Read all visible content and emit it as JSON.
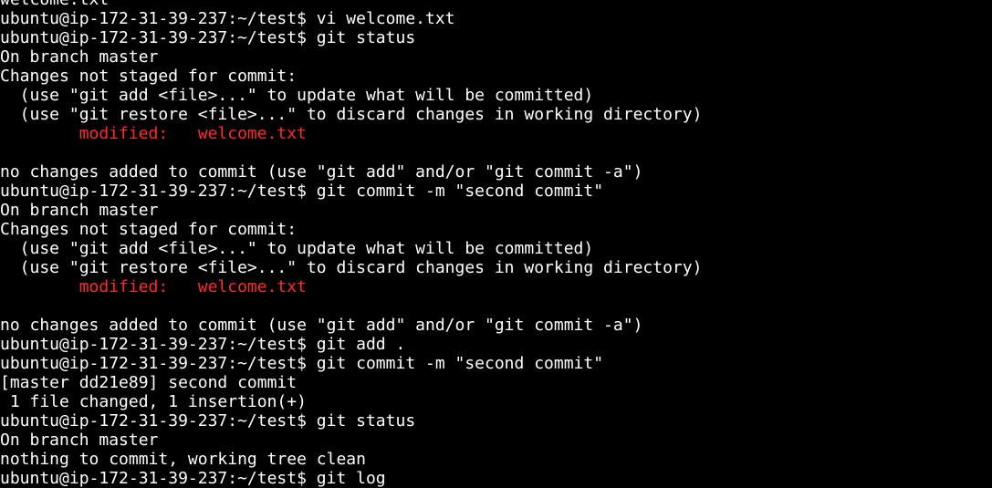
{
  "terminal": {
    "lines": [
      {
        "text": "welcome.txt"
      },
      {
        "text": "ubuntu@ip-172-31-39-237:~/test$ vi welcome.txt"
      },
      {
        "text": "ubuntu@ip-172-31-39-237:~/test$ git status"
      },
      {
        "text": "On branch master"
      },
      {
        "text": "Changes not staged for commit:"
      },
      {
        "text": "  (use \"git add <file>...\" to update what will be committed)"
      },
      {
        "text": "  (use \"git restore <file>...\" to discard changes in working directory)"
      },
      {
        "text": "        modified:   welcome.txt",
        "color": "red"
      },
      {
        "text": ""
      },
      {
        "text": "no changes added to commit (use \"git add\" and/or \"git commit -a\")"
      },
      {
        "text": "ubuntu@ip-172-31-39-237:~/test$ git commit -m \"second commit\""
      },
      {
        "text": "On branch master"
      },
      {
        "text": "Changes not staged for commit:"
      },
      {
        "text": "  (use \"git add <file>...\" to update what will be committed)"
      },
      {
        "text": "  (use \"git restore <file>...\" to discard changes in working directory)"
      },
      {
        "text": "        modified:   welcome.txt",
        "color": "red"
      },
      {
        "text": ""
      },
      {
        "text": "no changes added to commit (use \"git add\" and/or \"git commit -a\")"
      },
      {
        "text": "ubuntu@ip-172-31-39-237:~/test$ git add ."
      },
      {
        "text": "ubuntu@ip-172-31-39-237:~/test$ git commit -m \"second commit\""
      },
      {
        "text": "[master dd21e89] second commit"
      },
      {
        "text": " 1 file changed, 1 insertion(+)"
      },
      {
        "text": "ubuntu@ip-172-31-39-237:~/test$ git status"
      },
      {
        "text": "On branch master"
      },
      {
        "text": "nothing to commit, working tree clean"
      },
      {
        "text": "ubuntu@ip-172-31-39-237:~/test$ git log"
      }
    ]
  }
}
